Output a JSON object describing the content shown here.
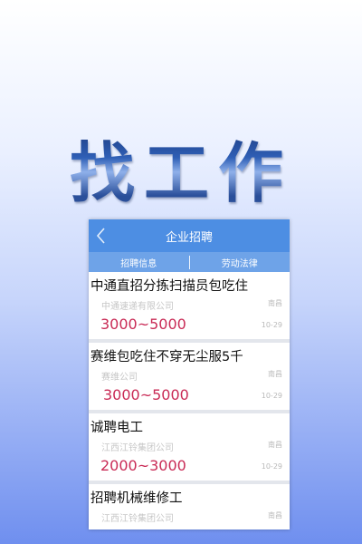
{
  "hero": {
    "title": "找工作"
  },
  "app": {
    "title": "企业招聘",
    "tabs": [
      {
        "label": "招聘信息"
      },
      {
        "label": "劳动法律"
      }
    ]
  },
  "jobs": [
    {
      "title": "中通直招分拣扫描员包吃住",
      "company": "中通速递有限公司",
      "location": "南昌",
      "salary": "3000~5000",
      "date": "10-29"
    },
    {
      "title": "赛维包吃住不穿无尘服5千",
      "company": "赛维公司",
      "location": "南昌",
      "salary": "3000~5000",
      "date": "10-29"
    },
    {
      "title": "诚聘电工",
      "company": "江西江铃集团公司",
      "location": "南昌",
      "salary": "2000~3000",
      "date": "10-29"
    },
    {
      "title": "招聘机械维修工",
      "company": "江西江铃集团公司",
      "location": "南昌",
      "salary": "",
      "date": ""
    }
  ],
  "icons": {
    "back": "chevron-left-icon"
  },
  "colors": {
    "topbar": "#4d8ee3",
    "tabbar": "#6ea3e8",
    "salary": "#c92b56"
  }
}
